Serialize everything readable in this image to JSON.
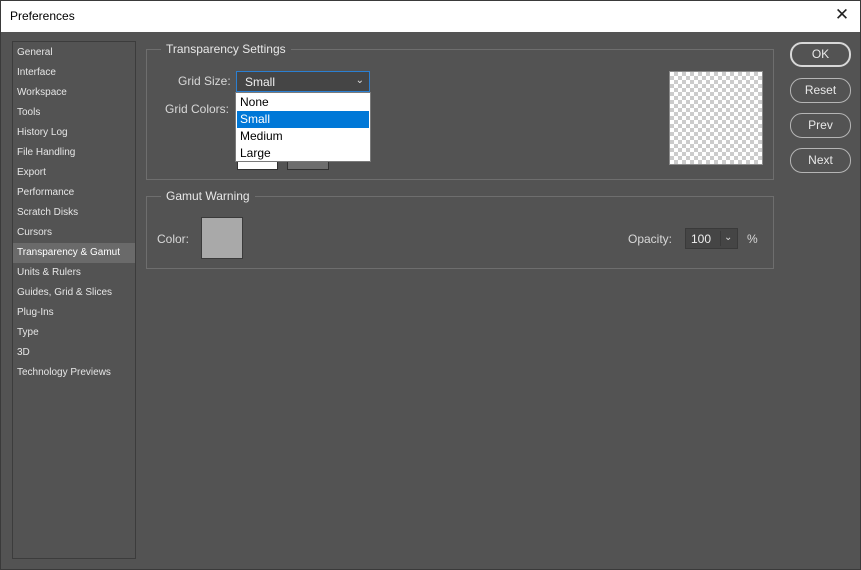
{
  "window": {
    "title": "Preferences",
    "close_glyph": "✕"
  },
  "sidebar": {
    "items": [
      {
        "label": "General"
      },
      {
        "label": "Interface"
      },
      {
        "label": "Workspace"
      },
      {
        "label": "Tools"
      },
      {
        "label": "History Log"
      },
      {
        "label": "File Handling"
      },
      {
        "label": "Export"
      },
      {
        "label": "Performance"
      },
      {
        "label": "Scratch Disks"
      },
      {
        "label": "Cursors"
      },
      {
        "label": "Transparency & Gamut"
      },
      {
        "label": "Units & Rulers"
      },
      {
        "label": "Guides, Grid & Slices"
      },
      {
        "label": "Plug-Ins"
      },
      {
        "label": "Type"
      },
      {
        "label": "3D"
      },
      {
        "label": "Technology Previews"
      }
    ],
    "selected": "Transparency & Gamut"
  },
  "transparency": {
    "legend": "Transparency Settings",
    "grid_size_label": "Grid Size:",
    "grid_size_value": "Small",
    "grid_colors_label": "Grid Colors:",
    "options": [
      "None",
      "Small",
      "Medium",
      "Large"
    ],
    "selected_option": "Small"
  },
  "gamut": {
    "legend": "Gamut Warning",
    "color_label": "Color:",
    "color_value": "#a9a9a9",
    "opacity_label": "Opacity:",
    "opacity_value": "100",
    "opacity_unit": "%"
  },
  "buttons": {
    "ok": "OK",
    "reset": "Reset",
    "prev": "Prev",
    "next": "Next"
  },
  "icons": {
    "dropdown_chevron": "⌄",
    "close": "close-icon"
  },
  "colors": {
    "accent": "#0078d7",
    "panel_bg": "#535353"
  }
}
